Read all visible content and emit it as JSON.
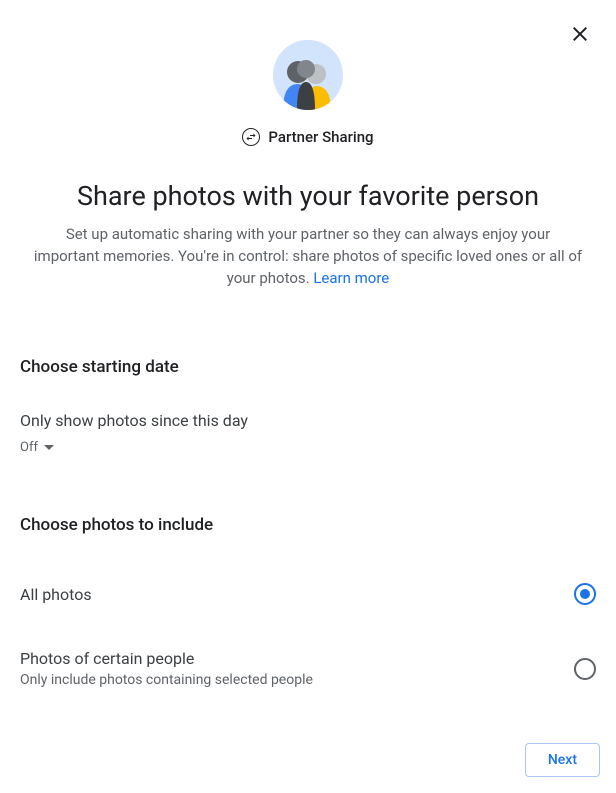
{
  "feature_label": "Partner Sharing",
  "title": "Share photos with your favorite person",
  "description": "Set up automatic sharing with your partner so they can always enjoy your important memories. You're in control: share photos of specific loved ones or all of your photos. ",
  "learn_more": "Learn more",
  "sections": {
    "date": {
      "heading": "Choose starting date",
      "label": "Only show photos since this day",
      "value": "Off"
    },
    "photos": {
      "heading": "Choose photos to include",
      "options": [
        {
          "title": "All photos",
          "subtitle": "",
          "selected": true
        },
        {
          "title": "Photos of certain people",
          "subtitle": "Only include photos containing selected people",
          "selected": false
        }
      ]
    }
  },
  "buttons": {
    "next": "Next"
  }
}
